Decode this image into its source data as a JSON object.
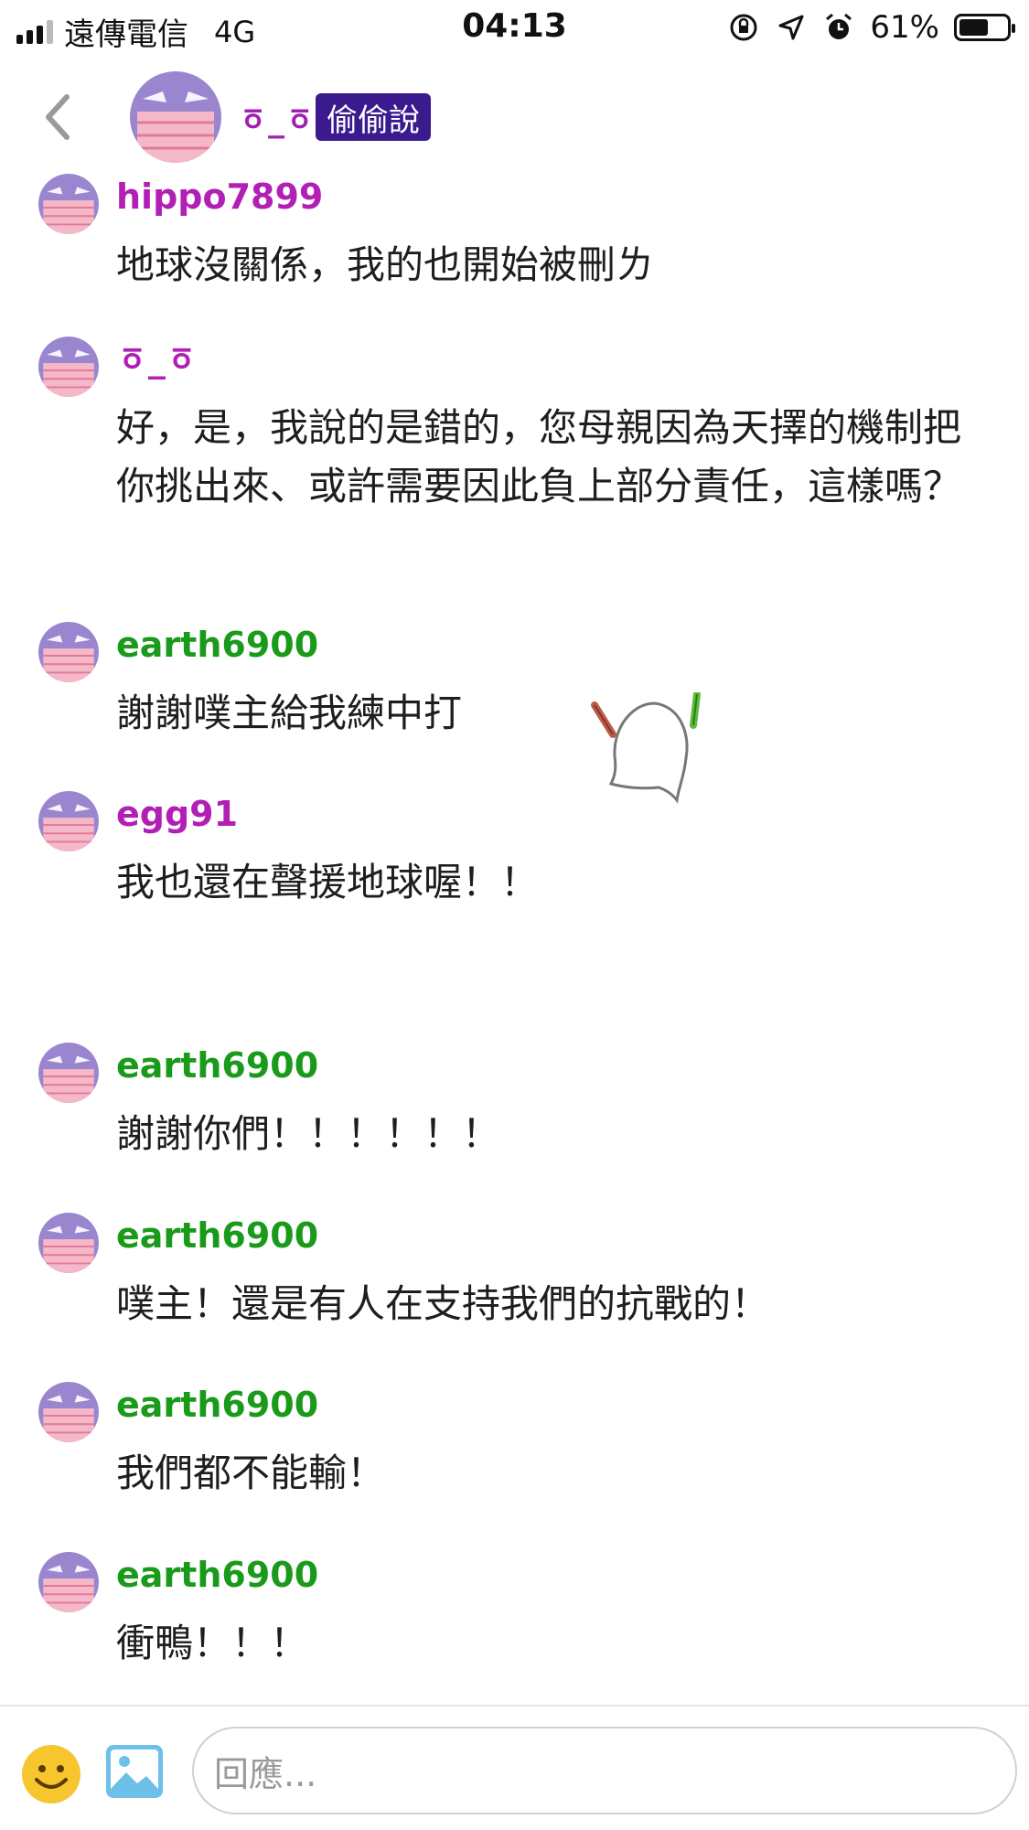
{
  "status_bar": {
    "carrier": "遠傳電信",
    "network": "4G",
    "time": "04:13",
    "battery_percent_text": "61%",
    "battery_level": 0.61,
    "icons": [
      "signal-icon",
      "rotation-lock-icon",
      "location-arrow-icon",
      "alarm-icon",
      "battery-icon"
    ]
  },
  "header": {
    "poster_name": "ㆆ_ㆆ",
    "badge": "偷偷說",
    "back_icon": "chevron-left-icon"
  },
  "colors": {
    "purple_name": "#b21fb5",
    "green_name": "#1a9a1a",
    "badge_bg": "#3a1a8c",
    "avatar_purple": "#9a86cf",
    "avatar_pink": "#f4b8c8"
  },
  "messages": [
    {
      "name": "hippo7899",
      "text": "地球沒關係，我的也開始被刪ㄌ"
    },
    {
      "name": "ㆆ_ㆆ",
      "text": "好，是，我說的是錯的，您母親因為天擇的機制把你挑出來、或許需要因此負上部分責任，這樣嗎？"
    },
    {
      "name": "earth6900",
      "text": "謝謝噗主給我練中打"
    },
    {
      "name": "egg91",
      "text": "我也還在聲援地球喔！！"
    },
    {
      "name": "earth6900",
      "text": "謝謝你們！！！！！！"
    },
    {
      "name": "earth6900",
      "text": "噗主！還是有人在支持我們的抗戰的！"
    },
    {
      "name": "earth6900",
      "text": "我們都不能輸！"
    },
    {
      "name": "earth6900",
      "text": "衝鴨！！！"
    }
  ],
  "bottom_bar": {
    "reply_placeholder": "回應...",
    "emoji_icon": "smiley-icon",
    "image_icon": "image-icon"
  }
}
